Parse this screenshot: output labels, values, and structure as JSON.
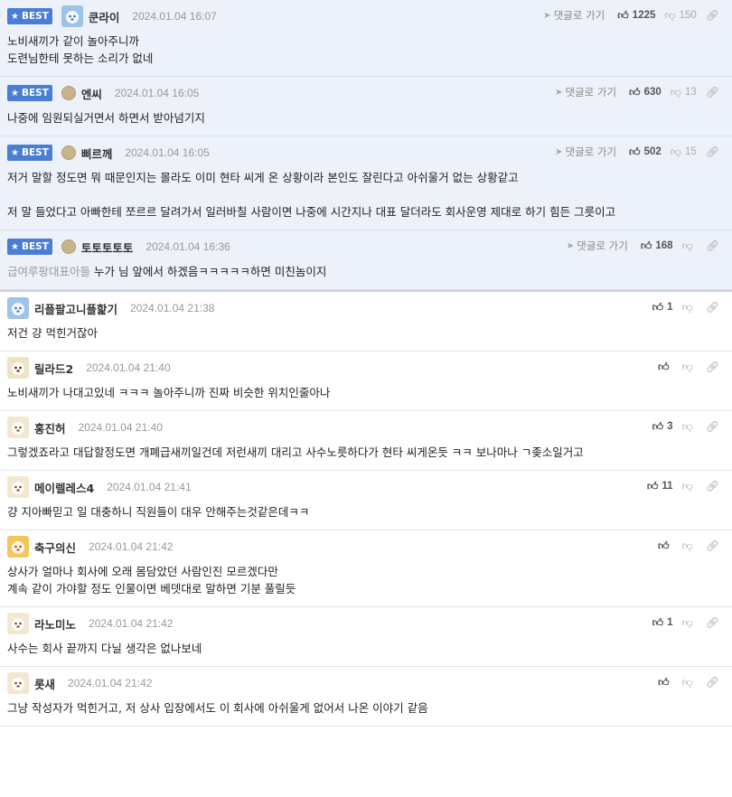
{
  "reply_label": "댓글로 가기",
  "best_label": "BEST",
  "best_comments": [
    {
      "avatar": "photo",
      "nick": "쿤라이",
      "date": "2024.01.04 16:07",
      "up": "1225",
      "down": "150",
      "text": "노비새끼가 같이 놀아주니까\n도련님한테 못하는 소리가 없네"
    },
    {
      "avatar": "dot",
      "nick": "엔씨",
      "date": "2024.01.04 16:05",
      "up": "630",
      "down": "13",
      "text": "나중에 임원되실거면서 하면서 받아넘기지"
    },
    {
      "avatar": "dot",
      "nick": "삐르께",
      "date": "2024.01.04 16:05",
      "up": "502",
      "down": "15",
      "text": "저거 말할 정도면 뭐 때문인지는 몰라도 이미 현타 씨게 온 상황이라 본인도 잘린다고 아쉬울거 없는 상황같고\n\n저 말 들었다고 아빠한테 쪼르르 달려가서 일러바칠 사람이면 나중에 시간지나 대표 달더라도 회사운영 제대로 하기 힘든 그릇이고"
    },
    {
      "avatar": "dot",
      "nick": "토토토토토",
      "date": "2024.01.04 16:36",
      "up": "168",
      "down": "",
      "prefix": "급여루팡대표아들",
      "text": " 누가 님 앞에서 하겠음ㅋㅋㅋㅋㅋ하면 미친놈이지"
    }
  ],
  "comments": [
    {
      "avatar": "photo",
      "nick": "리플팔고니플핥기",
      "date": "2024.01.04 21:38",
      "up": "1",
      "text": "저건 걍 먹힌거잖아"
    },
    {
      "avatar": "dog",
      "nick": "릴라드2",
      "date": "2024.01.04 21:40",
      "up": "",
      "text": "노비새끼가 나대고있네 ㅋㅋㅋ 놀아주니까 진짜 비슷한 위치인줄아나"
    },
    {
      "avatar": "puppy",
      "nick": "홍진허",
      "date": "2024.01.04 21:40",
      "up": "3",
      "text": "그렇겠죠라고 대답할정도면 개폐급새끼일건데 저런새끼 대리고 사수노릇하다가 현타 씨게온듯 ㅋㅋ 보나마나 ㄱ좆소일거고"
    },
    {
      "avatar": "puppy",
      "nick": "메이렐레스4",
      "date": "2024.01.04 21:41",
      "up": "11",
      "text": "걍 지아빠믿고 일 대충하니 직원들이 대우 안해주는것같은데ㅋㅋ"
    },
    {
      "avatar": "colorful",
      "nick": "축구의신",
      "date": "2024.01.04 21:42",
      "up": "",
      "text": "상사가 얼마나 회사에 오래 몸담았던 사람인진 모르겠다만\n계속 같이 가야할 정도 인물이면 베뎃대로 말하면 기분 풀릴듯"
    },
    {
      "avatar": "puppy",
      "nick": "라노미노",
      "date": "2024.01.04 21:42",
      "up": "1",
      "text": "사수는 회사 끝까지 다닐 생각은 없나보네"
    },
    {
      "avatar": "puppy",
      "nick": "롯새",
      "date": "2024.01.04 21:42",
      "up": "",
      "text": "그냥 작성자가 먹힌거고, 저 상사 입장에서도 이 회사에 아쉬울게 없어서 나온 이야기 같음"
    }
  ]
}
